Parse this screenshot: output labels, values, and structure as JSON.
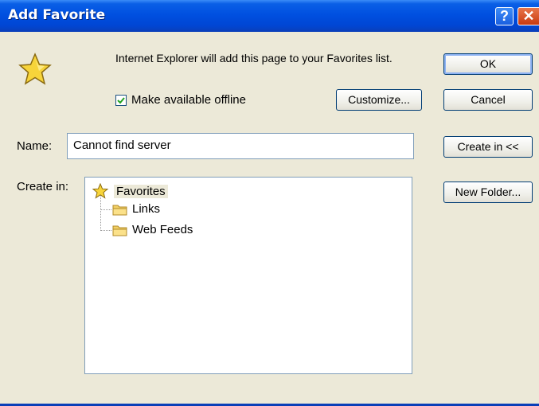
{
  "window": {
    "title": "Add Favorite",
    "help_glyph": "?",
    "close_glyph": "✕"
  },
  "dialog": {
    "message": "Internet Explorer will add this page to your Favorites list.",
    "offline_label": "Make available offline",
    "offline_checked": true,
    "name_label": "Name:",
    "name_value": "Cannot find server",
    "create_in_label": "Create in:"
  },
  "buttons": {
    "ok": "OK",
    "cancel": "Cancel",
    "customize": "Customize...",
    "create_in": "Create in <<",
    "new_folder": "New Folder..."
  },
  "tree": {
    "root": "Favorites",
    "children": [
      "Links",
      "Web Feeds"
    ]
  },
  "icons": {
    "favorites": "star-icon",
    "folder": "folder-icon"
  },
  "colors": {
    "titlebar": "#0050E0",
    "dialog_bg": "#ECE9D8",
    "star": "#F7D43A"
  }
}
